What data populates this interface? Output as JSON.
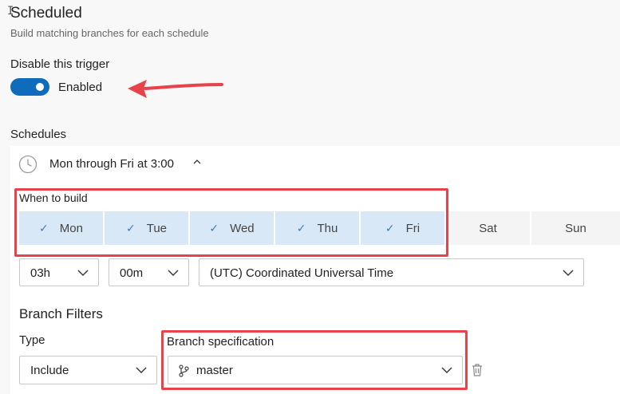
{
  "header": {
    "title": "Scheduled",
    "subtitle": "Build matching branches for each schedule"
  },
  "trigger": {
    "label": "Disable this trigger",
    "state_text": "Enabled",
    "enabled": true
  },
  "schedules": {
    "label": "Schedules",
    "summary": "Mon through Fri at 3:00",
    "when_label": "When to build",
    "days": [
      {
        "label": "Mon",
        "selected": true
      },
      {
        "label": "Tue",
        "selected": true
      },
      {
        "label": "Wed",
        "selected": true
      },
      {
        "label": "Thu",
        "selected": true
      },
      {
        "label": "Fri",
        "selected": true
      },
      {
        "label": "Sat",
        "selected": false
      },
      {
        "label": "Sun",
        "selected": false
      }
    ],
    "hour": "03h",
    "minute": "00m",
    "timezone": "(UTC) Coordinated Universal Time"
  },
  "branch_filters": {
    "heading": "Branch Filters",
    "type_label": "Type",
    "type_value": "Include",
    "spec_label": "Branch specification",
    "spec_value": "master"
  },
  "colors": {
    "accent": "#0f6cbd",
    "selected_day_bg": "#d9e8f7",
    "annotation_red": "#e8424a"
  }
}
